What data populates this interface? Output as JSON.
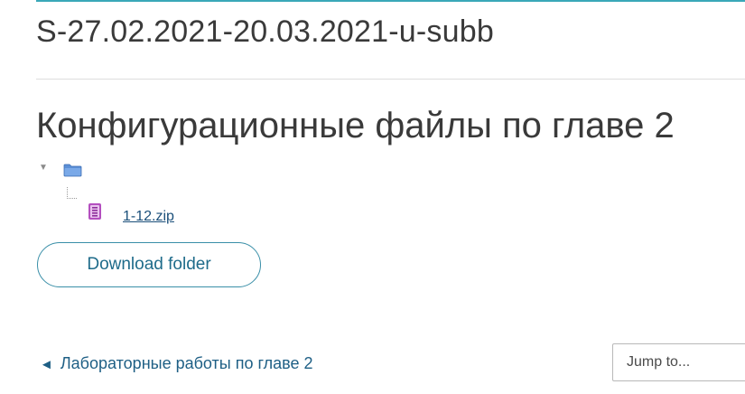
{
  "course": {
    "short_name": "S-27.02.2021-20.03.2021-u-subb"
  },
  "folder": {
    "title": "Конфигурационные файлы по главе 2",
    "files": [
      {
        "name": "1-12.zip",
        "icon": "archive-file-icon"
      }
    ],
    "download_button_label": "Download folder"
  },
  "navigation": {
    "previous_activity_arrow": "◄",
    "previous_activity_label": "Лабораторные работы по главе 2",
    "jump_to_placeholder": "Jump to..."
  },
  "colors": {
    "accent": "#3aa8b8",
    "link": "#1e5f85",
    "button_border": "#3a8fa8"
  }
}
